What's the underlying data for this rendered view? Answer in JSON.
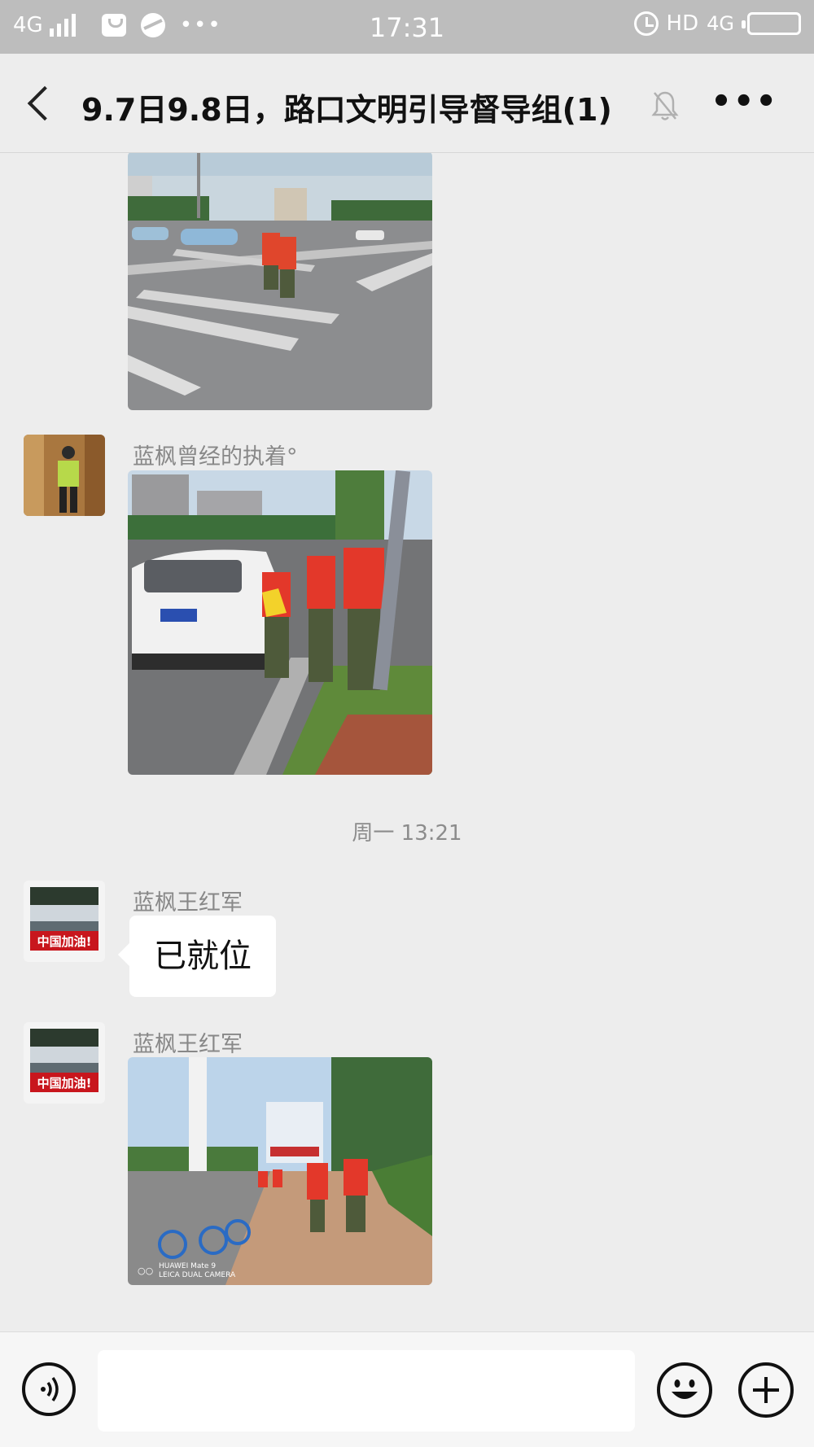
{
  "status_bar": {
    "network": "4G",
    "time": "17:31",
    "dots": "•••",
    "hd": "HD",
    "network_right": "4G"
  },
  "header": {
    "title": "9.7日9.8日，路口文明引导督导组(1)"
  },
  "messages": [
    {
      "type": "image",
      "sender": "",
      "description": "volunteers-at-crosswalk-photo"
    },
    {
      "type": "image",
      "sender": "蓝枫曾经的执着°",
      "description": "volunteers-by-white-suv-photo"
    },
    {
      "type": "timestamp",
      "text": "周一 13:21"
    },
    {
      "type": "text",
      "sender": "蓝枫王红军",
      "text": "已就位"
    },
    {
      "type": "image",
      "sender": "蓝枫王红军",
      "description": "volunteers-walking-sidewalk-photo"
    }
  ],
  "avatars": {
    "wanghongjun_banner": "中国加油!"
  },
  "photo_watermark": {
    "line1": "HUAWEI Mate 9",
    "line2": "LEICA DUAL CAMERA"
  },
  "input": {
    "placeholder": ""
  }
}
